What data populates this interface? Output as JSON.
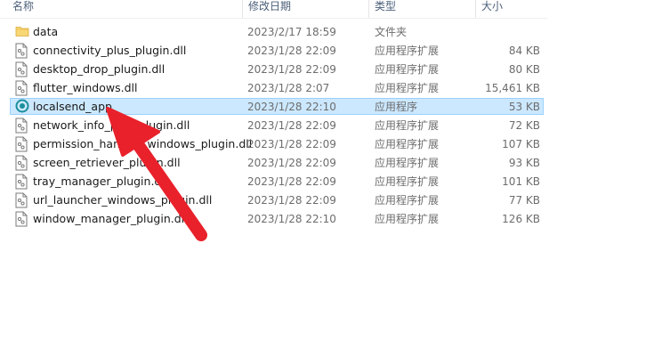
{
  "columns": {
    "name": "名称",
    "date": "修改日期",
    "type": "类型",
    "size": "大小"
  },
  "files": [
    {
      "name": "data",
      "date": "2023/2/17 18:59",
      "type": "文件夹",
      "size": "",
      "icon": "folder-icon"
    },
    {
      "name": "connectivity_plus_plugin.dll",
      "date": "2023/1/28 22:09",
      "type": "应用程序扩展",
      "size": "84 KB",
      "icon": "dll-file-icon"
    },
    {
      "name": "desktop_drop_plugin.dll",
      "date": "2023/1/28 22:09",
      "type": "应用程序扩展",
      "size": "80 KB",
      "icon": "dll-file-icon"
    },
    {
      "name": "flutter_windows.dll",
      "date": "2023/1/28 2:07",
      "type": "应用程序扩展",
      "size": "15,461 KB",
      "icon": "dll-file-icon"
    },
    {
      "name": "localsend_app",
      "date": "2023/1/28 22:10",
      "type": "应用程序",
      "size": "53 KB",
      "icon": "app-icon",
      "selected": true
    },
    {
      "name": "network_info_plus_plugin.dll",
      "date": "2023/1/28 22:09",
      "type": "应用程序扩展",
      "size": "72 KB",
      "icon": "dll-file-icon"
    },
    {
      "name": "permission_handler_windows_plugin.dll",
      "date": "2023/1/28 22:09",
      "type": "应用程序扩展",
      "size": "107 KB",
      "icon": "dll-file-icon"
    },
    {
      "name": "screen_retriever_plugin.dll",
      "date": "2023/1/28 22:09",
      "type": "应用程序扩展",
      "size": "93 KB",
      "icon": "dll-file-icon"
    },
    {
      "name": "tray_manager_plugin.dll",
      "date": "2023/1/28 22:09",
      "type": "应用程序扩展",
      "size": "101 KB",
      "icon": "dll-file-icon"
    },
    {
      "name": "url_launcher_windows_plugin.dll",
      "date": "2023/1/28 22:09",
      "type": "应用程序扩展",
      "size": "77 KB",
      "icon": "dll-file-icon"
    },
    {
      "name": "window_manager_plugin.dll",
      "date": "2023/1/28 22:10",
      "type": "应用程序扩展",
      "size": "126 KB",
      "icon": "dll-file-icon"
    }
  ],
  "colors": {
    "selection_bg": "#cce8ff",
    "selection_border": "#99d1ff",
    "folder": "#f8d775",
    "app_icon": "#1b8f9c",
    "arrow": "#e8212b"
  },
  "annotation": {
    "icon": "red-pointer-arrow-icon"
  }
}
